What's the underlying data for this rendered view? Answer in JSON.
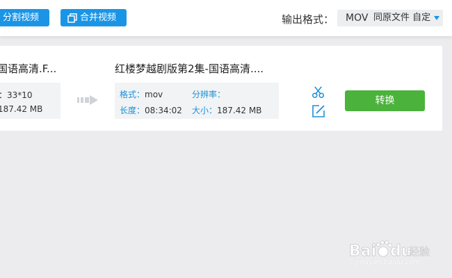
{
  "toolbar": {
    "split_label": "分割视频",
    "merge_label": "合并视频",
    "format_label": "输出格式：",
    "format_value": "MOV",
    "format_extra": "同原文件 自定"
  },
  "task": {
    "source": {
      "title": "国语高清.F...",
      "resolution_value": "33*10",
      "size_value": "187.42 MB"
    },
    "output": {
      "title": "红楼梦越剧版第2集-国语高清....",
      "format_key": "格式：",
      "format_value": "mov",
      "resolution_key": "分辨率：",
      "resolution_value": "",
      "duration_key": "长度：",
      "duration_value": "08:34:02",
      "size_key": "大小：",
      "size_value": "187.42 MB"
    },
    "convert_label": "转换"
  },
  "watermark": {
    "brand": "Bai du 经验",
    "url": "jingyan.baidu.com"
  },
  "colors": {
    "primary_blue": "#1a95e6",
    "convert_green": "#4bb23b",
    "label_blue": "#1a8fd8"
  },
  "icons": [
    "merge-icon",
    "dropdown-arrow-icon",
    "arrow-right-icon",
    "scissors-icon",
    "edit-icon",
    "baidu-paw-icon"
  ]
}
